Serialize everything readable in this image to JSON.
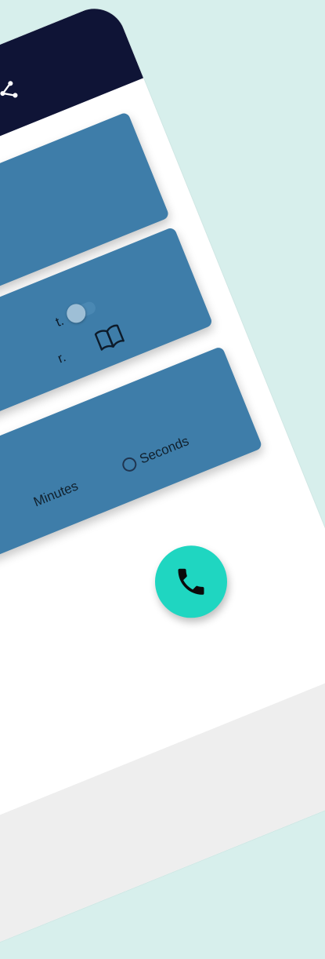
{
  "toggle": {
    "label": "t.",
    "on": false
  },
  "card2": {
    "text": "r."
  },
  "duration": {
    "options": [
      {
        "label": "Minutes",
        "selected": false
      },
      {
        "label": "Seconds",
        "selected": false
      }
    ]
  },
  "icons": {
    "share": "share-icon",
    "book": "book-icon",
    "call": "phone-icon"
  },
  "colors": {
    "background": "#d7efec",
    "appbar": "#0f1436",
    "card": "#3e7da9",
    "fab": "#1fd6c1"
  }
}
